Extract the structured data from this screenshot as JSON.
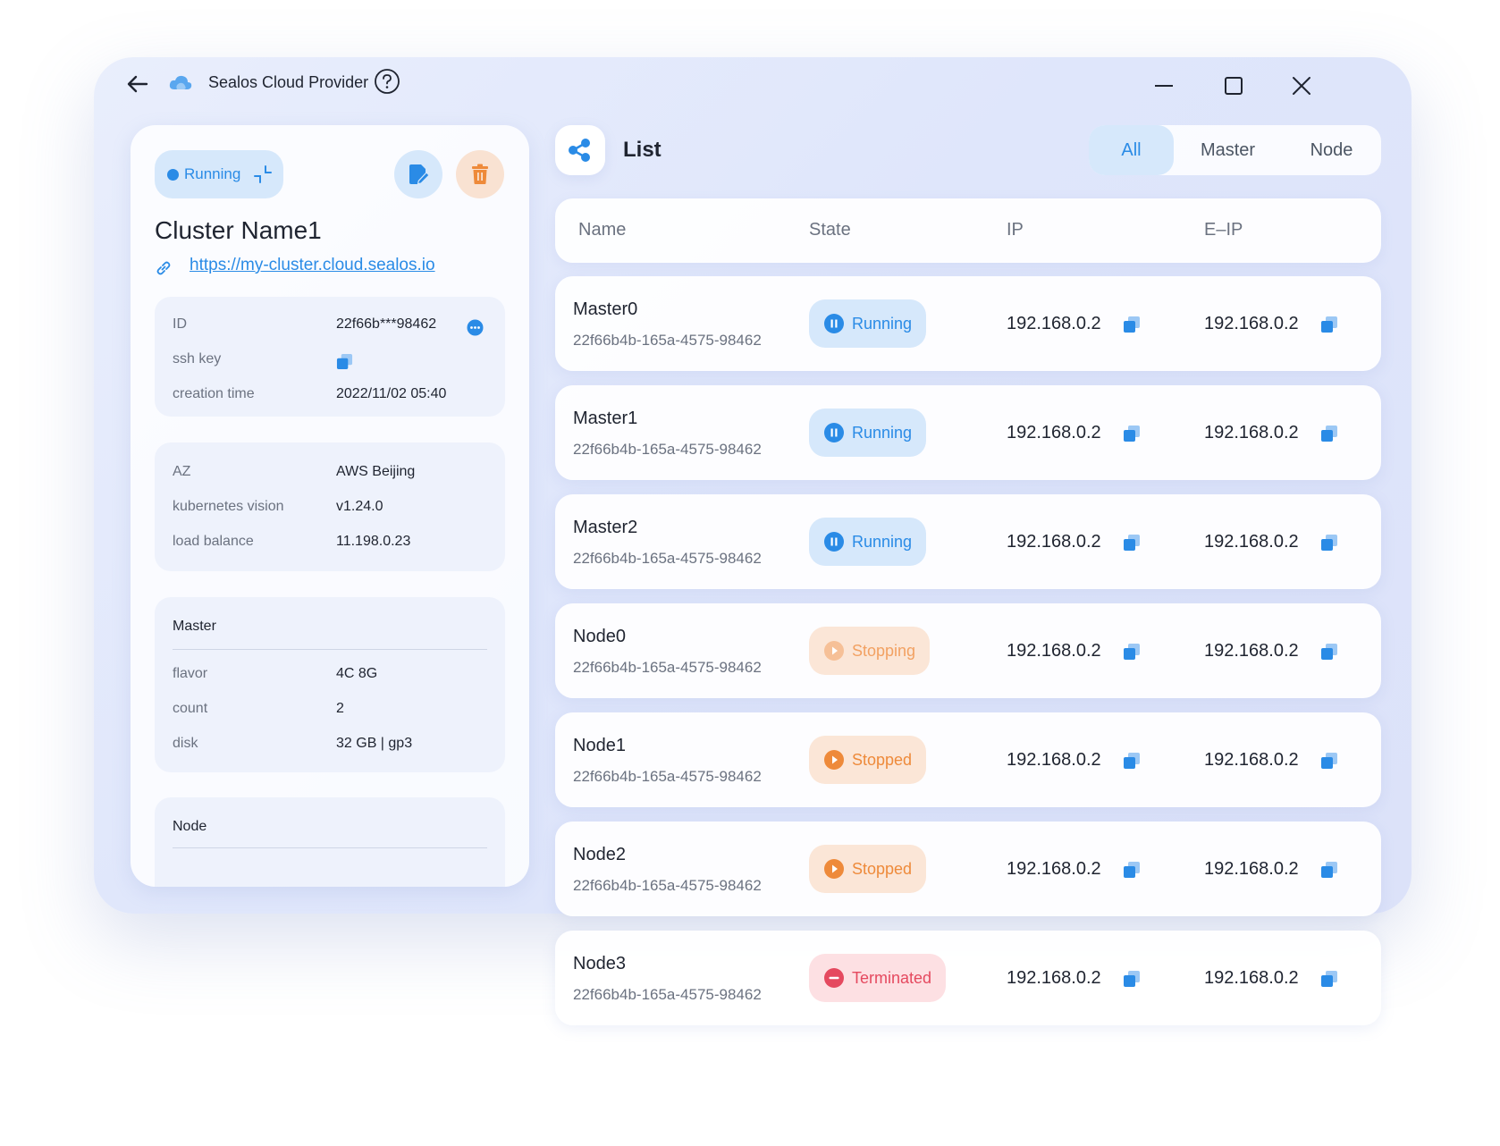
{
  "window": {
    "title": "Sealos Cloud Provider"
  },
  "cluster": {
    "status": "Running",
    "name": "Cluster Name1",
    "url": "https://my-cluster.cloud.sealos.io",
    "info": {
      "id_label": "ID",
      "id_value": "22f66b***98462",
      "ssh_label": "ssh key",
      "creation_label": "creation time",
      "creation_value": "2022/11/02  05:40"
    },
    "env": {
      "az_label": "AZ",
      "az_value": "AWS Beijing",
      "k8s_label": "kubernetes vision",
      "k8s_value": "v1.24.0",
      "lb_label": "load balance",
      "lb_value": "11.198.0.23"
    },
    "master": {
      "title": "Master",
      "flavor_label": "flavor",
      "flavor_value": "4C 8G",
      "count_label": "count",
      "count_value": "2",
      "disk_label": "disk",
      "disk_value": "32 GB | gp3"
    },
    "node": {
      "title": "Node"
    }
  },
  "list": {
    "title": "List",
    "tabs": [
      "All",
      "Master",
      "Node"
    ],
    "active_tab": "All",
    "columns": [
      "Name",
      "State",
      "IP",
      "E–IP"
    ],
    "rows": [
      {
        "name": "Master0",
        "uid": "22f66b4b-165a-4575-98462",
        "state": "Running",
        "ip": "192.168.0.2",
        "eip": "192.168.0.2"
      },
      {
        "name": "Master1",
        "uid": "22f66b4b-165a-4575-98462",
        "state": "Running",
        "ip": "192.168.0.2",
        "eip": "192.168.0.2"
      },
      {
        "name": "Master2",
        "uid": "22f66b4b-165a-4575-98462",
        "state": "Running",
        "ip": "192.168.0.2",
        "eip": "192.168.0.2"
      },
      {
        "name": "Node0",
        "uid": "22f66b4b-165a-4575-98462",
        "state": "Stopping",
        "ip": "192.168.0.2",
        "eip": "192.168.0.2"
      },
      {
        "name": "Node1",
        "uid": "22f66b4b-165a-4575-98462",
        "state": "Stopped",
        "ip": "192.168.0.2",
        "eip": "192.168.0.2"
      },
      {
        "name": "Node2",
        "uid": "22f66b4b-165a-4575-98462",
        "state": "Stopped",
        "ip": "192.168.0.2",
        "eip": "192.168.0.2"
      },
      {
        "name": "Node3",
        "uid": "22f66b4b-165a-4575-98462",
        "state": "Terminated",
        "ip": "192.168.0.2",
        "eip": "192.168.0.2"
      }
    ]
  },
  "colors": {
    "accent": "#2a8be6",
    "running": "#2a8be6",
    "stopping": "#f2a162",
    "stopped": "#ee8a3a",
    "terminated": "#e5495f",
    "delete": "#ee8a3a"
  },
  "icons": {
    "back": "arrow-left-icon",
    "logo": "cloud-icon",
    "help": "question-circle-icon",
    "minimize": "minimize-icon",
    "maximize": "maximize-icon",
    "close": "close-icon",
    "edit": "edit-icon",
    "delete": "trash-icon",
    "link": "link-icon",
    "copy": "copy-icon",
    "list": "share-icon"
  }
}
